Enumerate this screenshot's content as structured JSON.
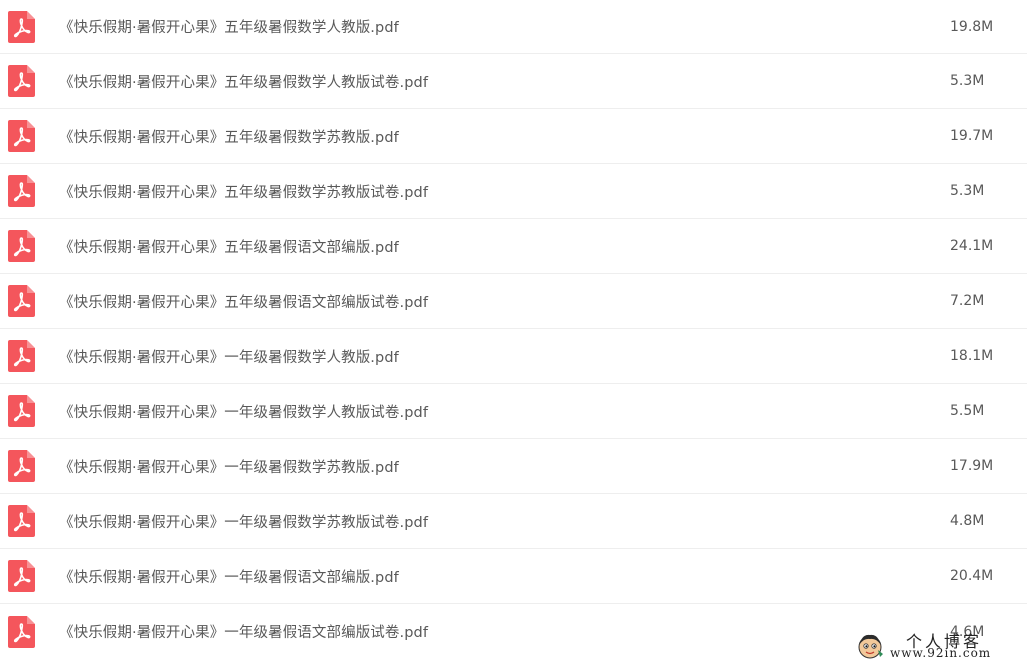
{
  "colors": {
    "pdf_icon": "#f4565c",
    "text": "#595959",
    "divider": "#eeeeee"
  },
  "files": [
    {
      "icon": "pdf-icon",
      "name": "《快乐假期·暑假开心果》五年级暑假数学人教版.pdf",
      "size": "19.8M"
    },
    {
      "icon": "pdf-icon",
      "name": "《快乐假期·暑假开心果》五年级暑假数学人教版试卷.pdf",
      "size": "5.3M"
    },
    {
      "icon": "pdf-icon",
      "name": "《快乐假期·暑假开心果》五年级暑假数学苏教版.pdf",
      "size": "19.7M"
    },
    {
      "icon": "pdf-icon",
      "name": "《快乐假期·暑假开心果》五年级暑假数学苏教版试卷.pdf",
      "size": "5.3M"
    },
    {
      "icon": "pdf-icon",
      "name": "《快乐假期·暑假开心果》五年级暑假语文部编版.pdf",
      "size": "24.1M"
    },
    {
      "icon": "pdf-icon",
      "name": "《快乐假期·暑假开心果》五年级暑假语文部编版试卷.pdf",
      "size": "7.2M"
    },
    {
      "icon": "pdf-icon",
      "name": "《快乐假期·暑假开心果》一年级暑假数学人教版.pdf",
      "size": "18.1M"
    },
    {
      "icon": "pdf-icon",
      "name": "《快乐假期·暑假开心果》一年级暑假数学人教版试卷.pdf",
      "size": "5.5M"
    },
    {
      "icon": "pdf-icon",
      "name": "《快乐假期·暑假开心果》一年级暑假数学苏教版.pdf",
      "size": "17.9M"
    },
    {
      "icon": "pdf-icon",
      "name": "《快乐假期·暑假开心果》一年级暑假数学苏教版试卷.pdf",
      "size": "4.8M"
    },
    {
      "icon": "pdf-icon",
      "name": "《快乐假期·暑假开心果》一年级暑假语文部编版.pdf",
      "size": "20.4M"
    },
    {
      "icon": "pdf-icon",
      "name": "《快乐假期·暑假开心果》一年级暑假语文部编版试卷.pdf",
      "size": "4.6M"
    }
  ],
  "watermark": {
    "title": "个人博客",
    "url": "www.92in.com",
    "avatar_icon": "cartoon-avatar-icon"
  }
}
